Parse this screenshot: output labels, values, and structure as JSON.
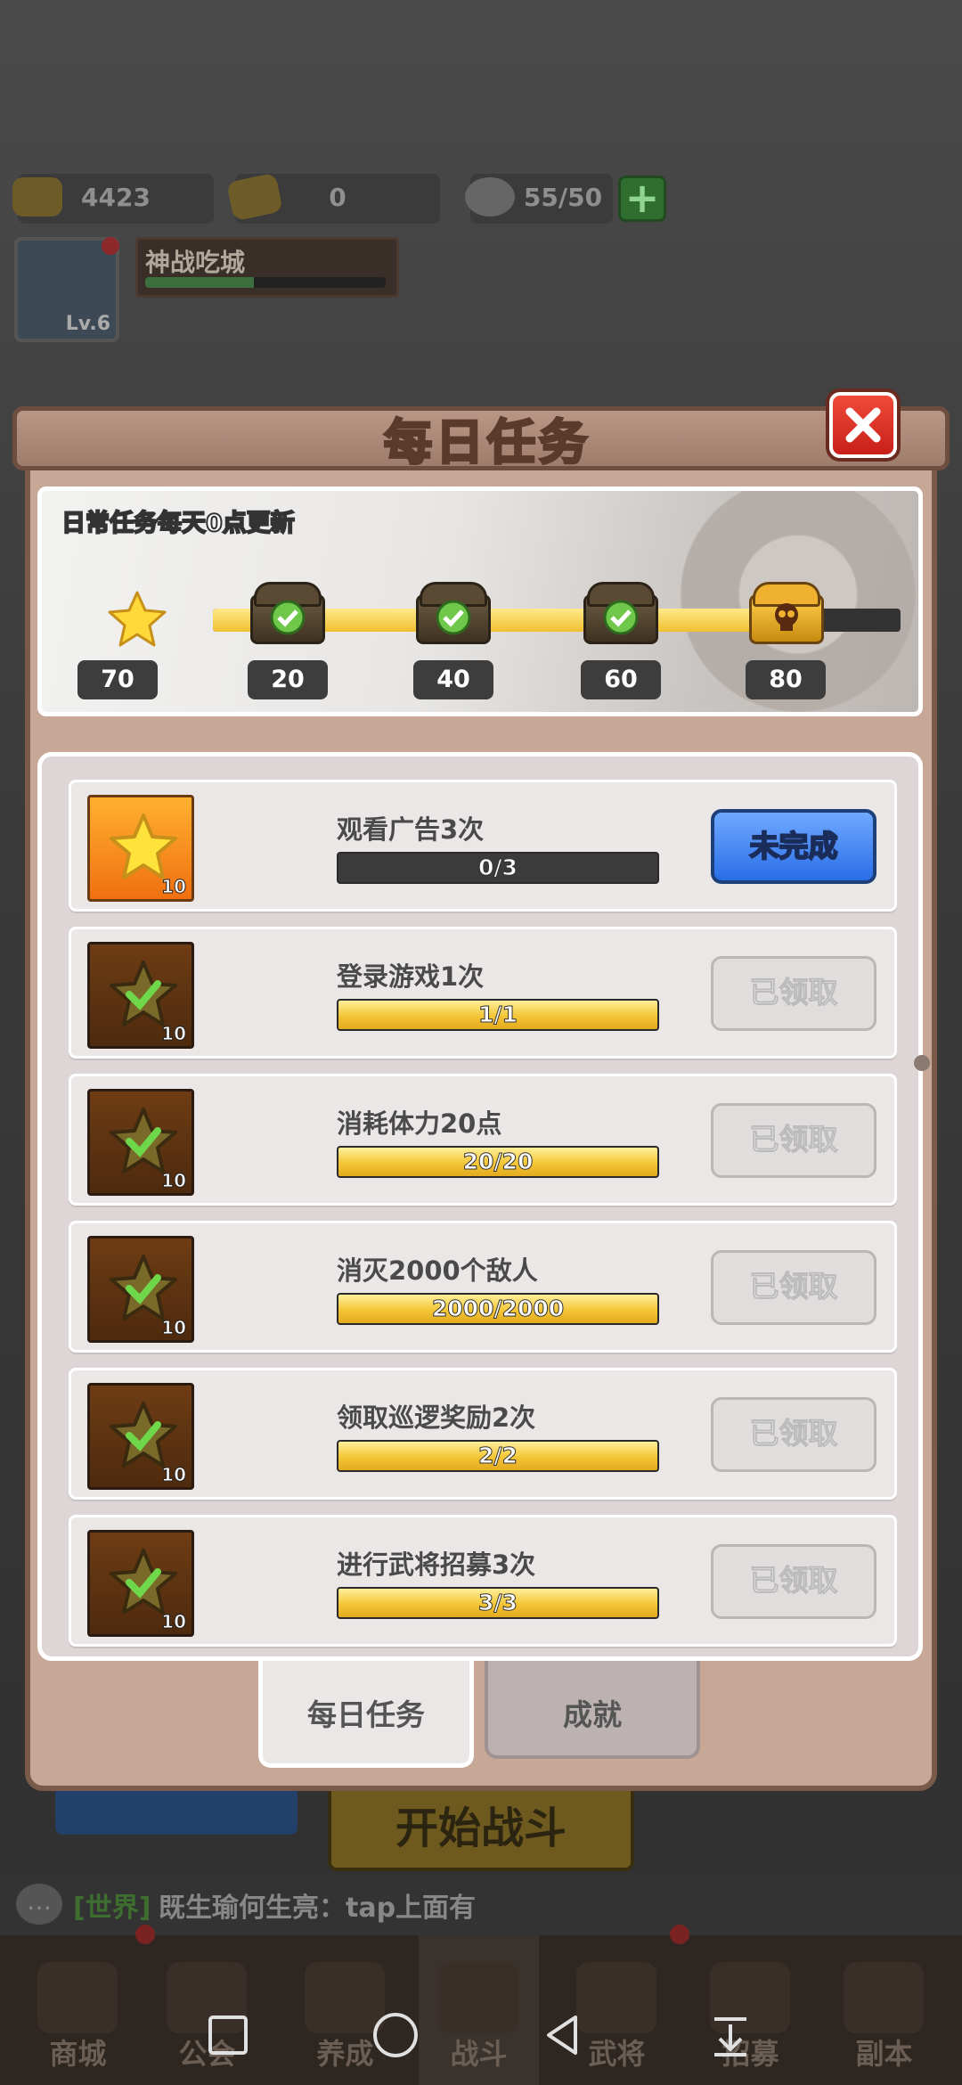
{
  "colors": {
    "accent_gold": "#f4c636",
    "accent_blue": "#2a6ee8",
    "panel": "#ded6d6",
    "frame": "#c7a795"
  },
  "resources": [
    {
      "icon": "gold-ingot-icon",
      "value": "4423"
    },
    {
      "icon": "ticket-icon",
      "value": "0"
    },
    {
      "icon": "bun-stamina-icon",
      "value": "55/50"
    }
  ],
  "player": {
    "name": "神战吃城",
    "level": "Lv.6"
  },
  "dialog": {
    "title": "每日任务",
    "note": "日常任务每天0点更新",
    "current_points": "70",
    "progress_fraction": 0.85,
    "milestones": [
      {
        "points": "20",
        "claimed": true
      },
      {
        "points": "40",
        "claimed": true
      },
      {
        "points": "60",
        "claimed": true
      },
      {
        "points": "80",
        "claimed": false
      }
    ],
    "tasks": [
      {
        "name": "观看广告3次",
        "progress": "0/3",
        "fill": 0.0,
        "reward_qty": "10",
        "button": "未完成",
        "state": "go"
      },
      {
        "name": "登录游戏1次",
        "progress": "1/1",
        "fill": 1.0,
        "reward_qty": "10",
        "button": "已领取",
        "state": "done"
      },
      {
        "name": "消耗体力20点",
        "progress": "20/20",
        "fill": 1.0,
        "reward_qty": "10",
        "button": "已领取",
        "state": "done"
      },
      {
        "name": "消灭2000个敌人",
        "progress": "2000/2000",
        "fill": 1.0,
        "reward_qty": "10",
        "button": "已领取",
        "state": "done"
      },
      {
        "name": "领取巡逻奖励2次",
        "progress": "2/2",
        "fill": 1.0,
        "reward_qty": "10",
        "button": "已领取",
        "state": "done"
      },
      {
        "name": "进行武将招募3次",
        "progress": "3/3",
        "fill": 1.0,
        "reward_qty": "10",
        "button": "已领取",
        "state": "done"
      }
    ],
    "tabs": [
      {
        "label": "每日任务",
        "active": true
      },
      {
        "label": "成就",
        "active": false
      }
    ]
  },
  "background": {
    "start_battle": "开始战斗",
    "chat_channel": "[世界]",
    "chat_message": "既生瑜何生亮：tap上面有",
    "nav": [
      "商城",
      "公会",
      "养成",
      "战斗",
      "武将",
      "招募",
      "副本"
    ]
  }
}
